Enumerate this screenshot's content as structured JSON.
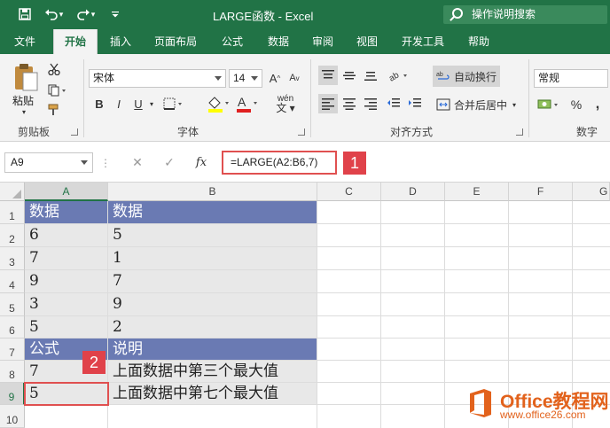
{
  "titlebar": {
    "title": "LARGE函数  -  Excel",
    "tell_me": "操作说明搜索"
  },
  "tabs": [
    "文件",
    "开始",
    "插入",
    "页面布局",
    "公式",
    "数据",
    "审阅",
    "视图",
    "开发工具",
    "帮助"
  ],
  "ribbon": {
    "clipboard": {
      "paste_label": "粘贴",
      "group_label": "剪贴板"
    },
    "font": {
      "font_name": "宋体",
      "font_size": "14",
      "group_label": "字体",
      "bold": "B",
      "italic": "I",
      "underline": "U",
      "grow": "A",
      "shrink": "A",
      "phonetic": "wén"
    },
    "alignment": {
      "wrap_text": "自动换行",
      "merge_center": "合并后居中",
      "group_label": "对齐方式"
    },
    "number": {
      "format": "常规",
      "percent": "%",
      "group_label": "数字"
    }
  },
  "formula_bar": {
    "name_box": "A9",
    "fx": "fx",
    "formula": "=LARGE(A2:B6,7)"
  },
  "badges": [
    "1",
    "2"
  ],
  "columns": [
    "A",
    "B",
    "C",
    "D",
    "E",
    "F",
    "G"
  ],
  "rows": [
    "1",
    "2",
    "3",
    "4",
    "5",
    "6",
    "7",
    "8",
    "9",
    "10"
  ],
  "sheet": {
    "a": [
      "数据",
      "6",
      "7",
      "9",
      "3",
      "5",
      "公式",
      "7",
      "5"
    ],
    "b": [
      "数据",
      "5",
      "1",
      "7",
      "9",
      "2",
      "说明",
      "上面数据中第三个最大值",
      "上面数据中第七个最大值"
    ]
  },
  "watermark": {
    "title": "Office教程网",
    "url": "www.office26.com"
  },
  "colors": {
    "excel_green": "#217346",
    "header_fill": "#6a7ab3",
    "body_fill": "#e8e8e8",
    "callout_red": "#e0424a",
    "watermark_orange": "#e2621c"
  }
}
